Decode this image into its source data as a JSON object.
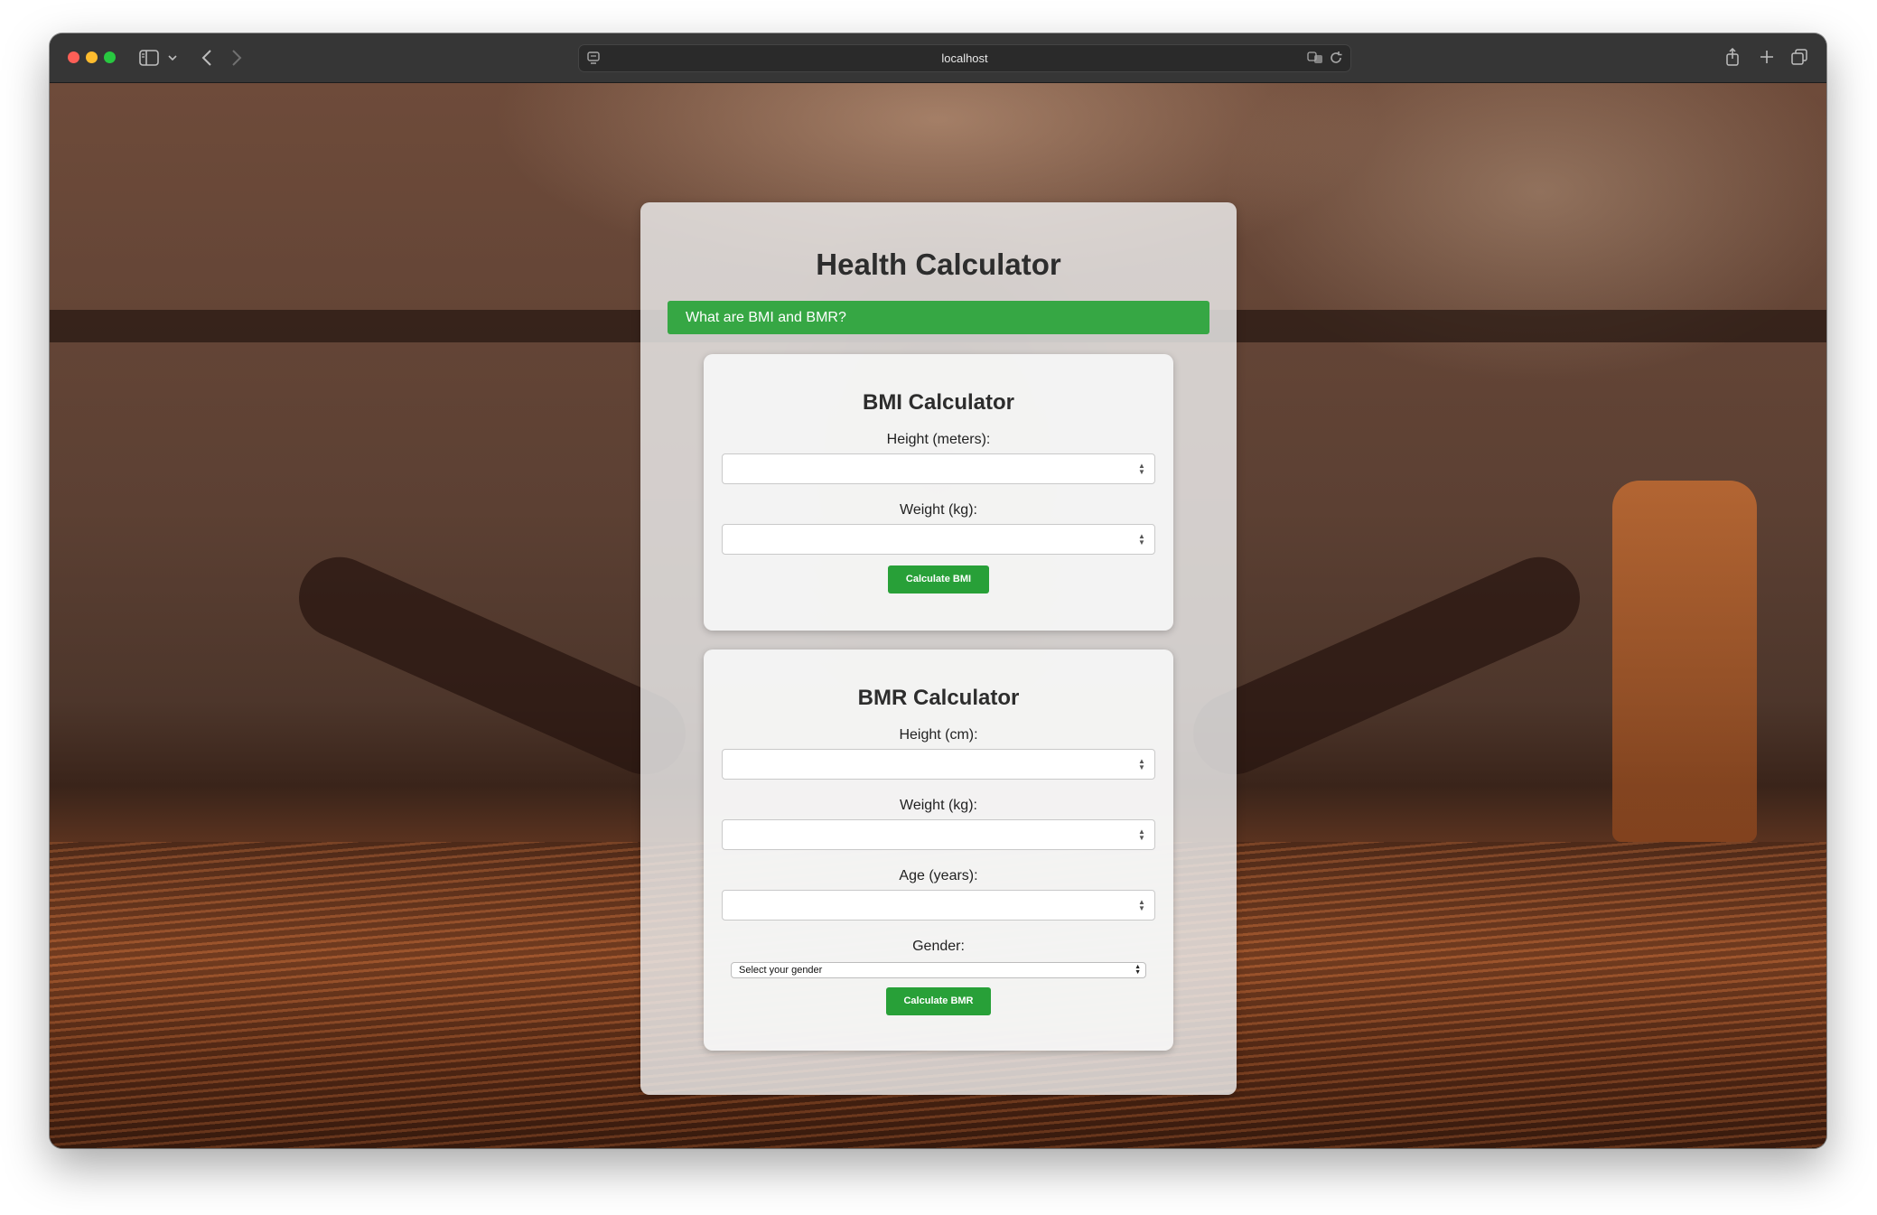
{
  "browser": {
    "url": "localhost"
  },
  "app": {
    "title": "Health Calculator",
    "info_label": "What are BMI and BMR?",
    "accent_color": "#36a744"
  },
  "bmi": {
    "title": "BMI Calculator",
    "height_label": "Height (meters):",
    "height_value": "",
    "weight_label": "Weight (kg):",
    "weight_value": "",
    "button": "Calculate BMI"
  },
  "bmr": {
    "title": "BMR Calculator",
    "height_label": "Height (cm):",
    "height_value": "",
    "weight_label": "Weight (kg):",
    "weight_value": "",
    "age_label": "Age (years):",
    "age_value": "",
    "gender_label": "Gender:",
    "gender_selected": "Select your gender",
    "button": "Calculate BMR"
  },
  "icons": [
    "sidebar-icon",
    "chevron-down-icon",
    "back-arrow-icon",
    "forward-arrow-icon",
    "site-settings-icon",
    "translate-icon",
    "reload-icon",
    "share-icon",
    "new-tab-icon",
    "tab-overview-icon"
  ]
}
